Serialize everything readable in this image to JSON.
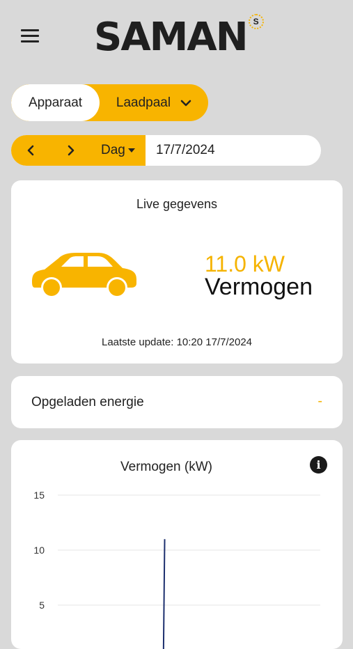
{
  "header": {
    "menu_icon": "hamburger-menu-icon",
    "logo_text": "SAMAN",
    "logo_badge": "S"
  },
  "toggle": {
    "left_label": "Apparaat",
    "right_label": "Laadpaal",
    "right_icon": "chevron-down-icon"
  },
  "datebar": {
    "period": "Dag",
    "date": "17/7/2024"
  },
  "live": {
    "title": "Live gegevens",
    "power_value": "11.0 kW",
    "power_label": "Vermogen",
    "last_update": "Laatste update: 10:20 17/7/2024"
  },
  "energy": {
    "label": "Opgeladen energie",
    "value": "-"
  },
  "colors": {
    "accent": "#f8b400",
    "line": "#1c2f6e"
  },
  "chart_data": {
    "type": "line",
    "title": "Vermogen (kW)",
    "ylabel": "",
    "xlabel": "",
    "y_ticks": [
      "15",
      "10",
      "5"
    ],
    "ylim": [
      0,
      15
    ],
    "grid": true,
    "series": [
      {
        "x": [
          0.0,
          0.0
        ],
        "y": [
          0.0,
          11.0
        ]
      }
    ]
  }
}
